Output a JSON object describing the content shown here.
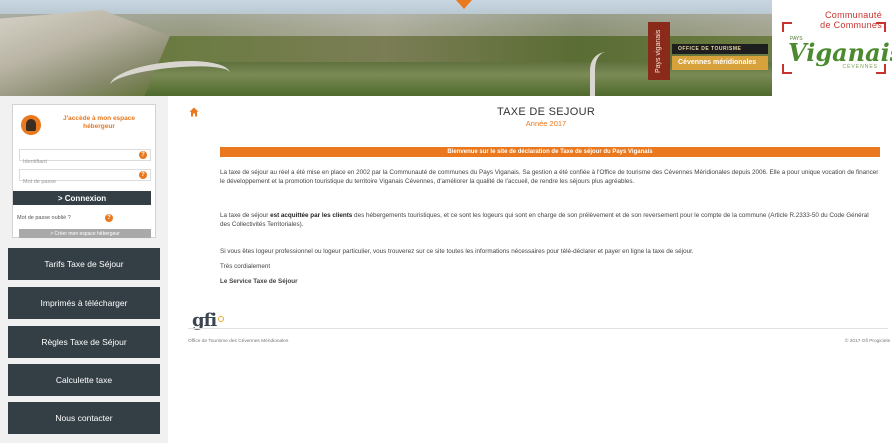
{
  "banner": {
    "vertical_tag": "Pays viganais",
    "office_label": "OFFICE DE TOURISME",
    "cevennes_label": "Cévennes méridionales",
    "logo_line1": "Communauté",
    "logo_line2": "de Communes",
    "logo_pays": "PAYS",
    "logo_main": "Viganais",
    "logo_sub": "CÉVENNES"
  },
  "login": {
    "title": "J'accède à mon espace hébergeur",
    "username_placeholder": "Identifiant",
    "password_placeholder": "Mot de passe",
    "help_glyph": "?",
    "connect_label": "> Connexion",
    "forgot_label": "Mot de passe oublié ?",
    "create_label": "> Créer mon espace hébergeur"
  },
  "nav": {
    "items": [
      {
        "label": "Tarifs Taxe de Séjour"
      },
      {
        "label": "Imprimés à télécharger"
      },
      {
        "label": "Règles Taxe de Séjour"
      },
      {
        "label": "Calculette taxe"
      },
      {
        "label": "Nous contacter"
      }
    ]
  },
  "main": {
    "title": "TAXE DE SEJOUR",
    "year": "Année 2017",
    "welcome": "Bienvenue sur le site de déclaration de Taxe de séjour du Pays Viganais",
    "p1": "La taxe de séjour au réel a été mise en place en 2002 par la Communauté de communes du Pays Viganais. Sa gestion a été confiée à l'Office de tourisme des Cévennes Méridionales depuis 2006. Elle a pour unique vocation de financer le développement et la promotion touristique du territoire Viganais Cévennes, d'améliorer la qualité de l'accueil, de rendre les séjours plus agréables.",
    "p2_a": "La taxe de séjour ",
    "p2_b": "est acquittée par les clients",
    "p2_c": " des hébergements touristiques, et ce sont les logeurs qui sont en charge de son prélèvement et de son reversement pour le compte de la commune (Article R.2333-50 du Code Général des Collectivités Territoriales).",
    "p3": "Si vous êtes logeur professionnel ou logeur particulier, vous trouverez sur ce site toutes les informations nécessaires pour télé-déclarer et payer en ligne la taxe de séjour.",
    "p4": "Très cordialement",
    "p5": "Le Service Taxe de Séjour"
  },
  "footer": {
    "brand": "gfi",
    "left": "Office de Tourisme des Cévennes Méridionales",
    "right": "© 2017 Gfi Progiciels"
  },
  "colors": {
    "accent": "#e9781e",
    "nav_bg": "#333e45",
    "sidebar_bg": "#f1f1f1"
  },
  "icons": {
    "home": "home-icon",
    "help": "help-icon",
    "user": "user-avatar-icon"
  }
}
